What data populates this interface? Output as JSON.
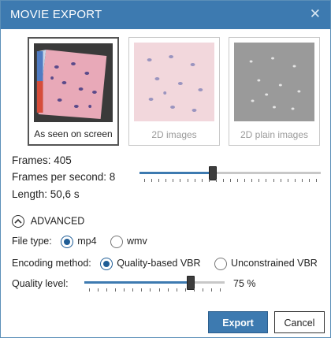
{
  "title": "MOVIE EXPORT",
  "close_glyph": "✕",
  "modes": [
    {
      "label": "As seen on screen",
      "selected": true
    },
    {
      "label": "2D images",
      "selected": false
    },
    {
      "label": "2D plain images",
      "selected": false
    }
  ],
  "info": {
    "frames": "Frames: 405",
    "fps": "Frames per second: 8",
    "length": "Length: 50,6 s"
  },
  "fps_slider": {
    "value_fraction": 0.4
  },
  "advanced": {
    "label": "ADVANCED",
    "icon": "chevron-up-icon"
  },
  "file_type": {
    "label": "File type:",
    "options": [
      {
        "label": "mp4",
        "selected": true
      },
      {
        "label": "wmv",
        "selected": false
      }
    ]
  },
  "encoding": {
    "label": "Encoding method:",
    "options": [
      {
        "label": "Quality-based VBR",
        "selected": true
      },
      {
        "label": "Unconstrained VBR",
        "selected": false
      }
    ]
  },
  "quality": {
    "label": "Quality level:",
    "value_text": "75 %",
    "value_fraction": 0.75
  },
  "buttons": {
    "export": "Export",
    "cancel": "Cancel"
  },
  "colors": {
    "accent": "#3d7ab0",
    "titlebar": "#3d7ab0"
  }
}
